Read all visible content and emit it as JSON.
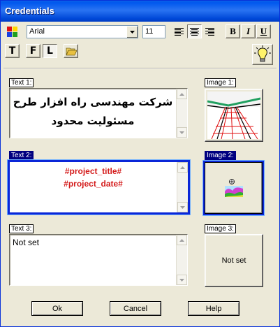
{
  "window": {
    "title": "Credentials"
  },
  "toolbar": {
    "font_name": "Arial",
    "font_size": "11",
    "bold_label": "B",
    "italic_label": "I",
    "underline_label": "U",
    "type_t_label": "T",
    "type_f_label": "F",
    "type_l_label": "L",
    "align_selected": "center"
  },
  "text_fields": [
    {
      "label": "Text 1:",
      "lines": [
        "شرکت مهندسی راه افزار طرح",
        "مسئولیت محدود"
      ],
      "color": "#000000"
    },
    {
      "label": "Text 2:",
      "lines": [
        "#project_title#",
        "#project_date#"
      ],
      "color": "#d41c1c"
    },
    {
      "label": "Text 3:",
      "lines": [
        "Not set"
      ],
      "color": "#000000"
    }
  ],
  "image_fields": [
    {
      "label": "Image 1:",
      "content": "road-3d-preview-icon"
    },
    {
      "label": "Image 2:",
      "content": "terrain-map-icon"
    },
    {
      "label": "Image 3:",
      "text": "Not set"
    }
  ],
  "buttons": {
    "ok": "Ok",
    "cancel": "Cancel",
    "help": "Help"
  }
}
